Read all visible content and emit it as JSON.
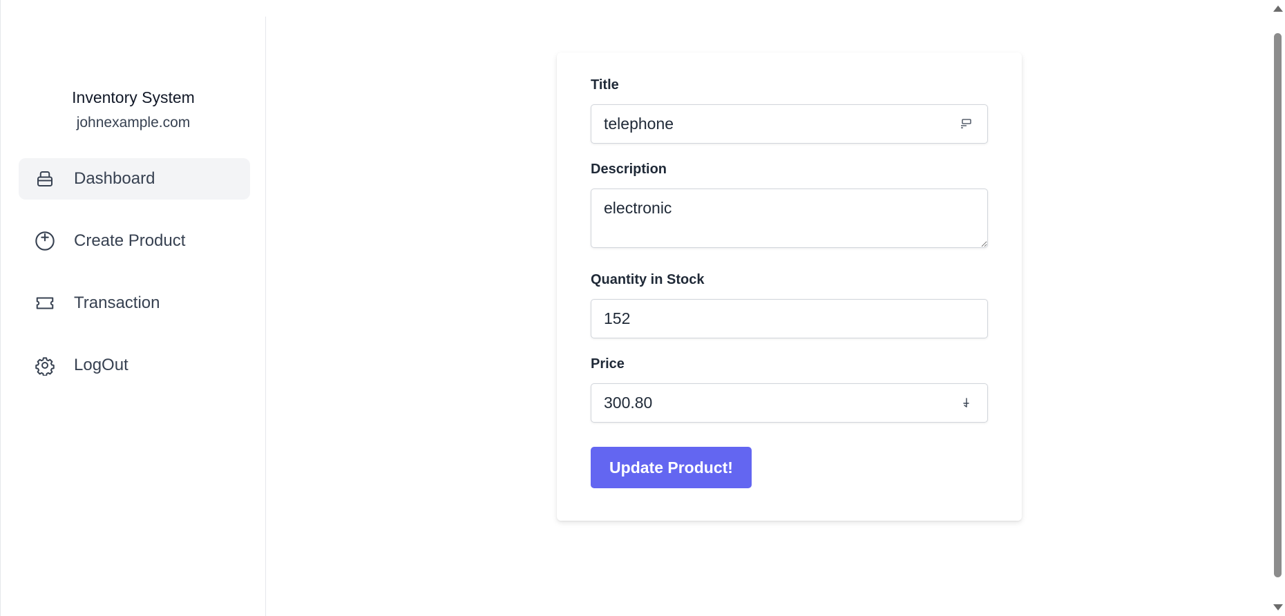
{
  "sidebar": {
    "brand_title": "Inventory System",
    "brand_subtitle": "johnexample.com",
    "items": [
      {
        "label": "Dashboard",
        "icon": "inbox-icon",
        "active": true
      },
      {
        "label": "Create Product",
        "icon": "plus-circle-icon",
        "active": false
      },
      {
        "label": "Transaction",
        "icon": "ticket-icon",
        "active": false
      },
      {
        "label": "LogOut",
        "icon": "gear-icon",
        "active": false
      }
    ]
  },
  "form": {
    "title_label": "Title",
    "title_value": "telephone",
    "description_label": "Description",
    "description_value": "electronic",
    "quantity_label": "Quantity in Stock",
    "quantity_value": "152",
    "price_label": "Price",
    "price_value": "300.80",
    "submit_label": "Update Product!"
  },
  "colors": {
    "accent": "#6366f1",
    "active_nav_bg": "#f3f4f6",
    "border": "#d1d5db"
  }
}
